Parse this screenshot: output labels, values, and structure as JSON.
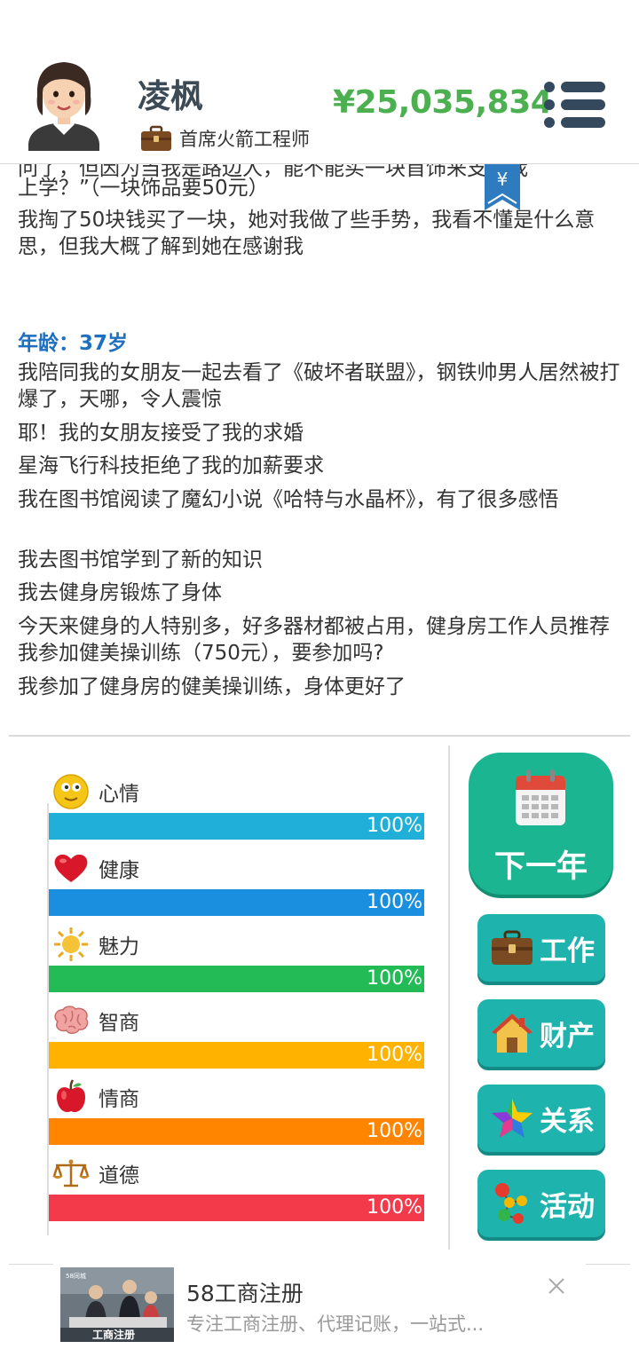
{
  "header": {
    "name": "凌枫",
    "job_title": "首席火箭工程师",
    "money": "¥25,035,834",
    "money_tab_symbol": "¥"
  },
  "log": {
    "cut_line": "问了，但因为当我是路边人，能不能买一块首饰来支持我",
    "lines_top": [
      "上学？”（一块饰品要50元）",
      "我掏了50块钱买了一块，她对我做了些手势，我看不懂是什么意思，但我大概了解到她在感谢我"
    ],
    "age_header": "年龄：37岁",
    "lines": [
      "我陪同我的女朋友一起去看了《破坏者联盟》，钢铁帅男人居然被打爆了，天哪，令人震惊",
      "耶！我的女朋友接受了我的求婚",
      "星海飞行科技拒绝了我的加薪要求",
      "我在图书馆阅读了魔幻小说《哈特与水晶杯》，有了很多感悟",
      "我去图书馆学到了新的知识",
      "我去健身房锻炼了身体",
      "今天来健身的人特别多，好多器材都被占用，健身房工作人员推荐我参加健美操训练（750元），要参加吗?",
      "我参加了健身房的健美操训练，身体更好了"
    ]
  },
  "stats": [
    {
      "label": "心情",
      "value": "100%",
      "fraction": 1.0,
      "color": "#1fafd8",
      "icon": "smiley-icon"
    },
    {
      "label": "健康",
      "value": "100%",
      "fraction": 1.0,
      "color": "#1a8fe0",
      "icon": "heart-icon"
    },
    {
      "label": "魅力",
      "value": "100%",
      "fraction": 1.0,
      "color": "#22bb55",
      "icon": "sun-icon"
    },
    {
      "label": "智商",
      "value": "100%",
      "fraction": 1.0,
      "color": "#ffb300",
      "icon": "brain-icon"
    },
    {
      "label": "情商",
      "value": "100%",
      "fraction": 1.0,
      "color": "#ff8400",
      "icon": "apple-icon"
    },
    {
      "label": "道德",
      "value": "100%",
      "fraction": 1.0,
      "color": "#f23a4a",
      "icon": "scales-icon"
    }
  ],
  "actions": {
    "next_year": "下一年",
    "work": "工作",
    "property": "财产",
    "relations": "关系",
    "activity": "活动"
  },
  "ad": {
    "title": "58工商注册",
    "subtitle": "专注工商注册、代理记账，一站式...",
    "image_caption": "工商注册",
    "image_logo": "58同城"
  }
}
